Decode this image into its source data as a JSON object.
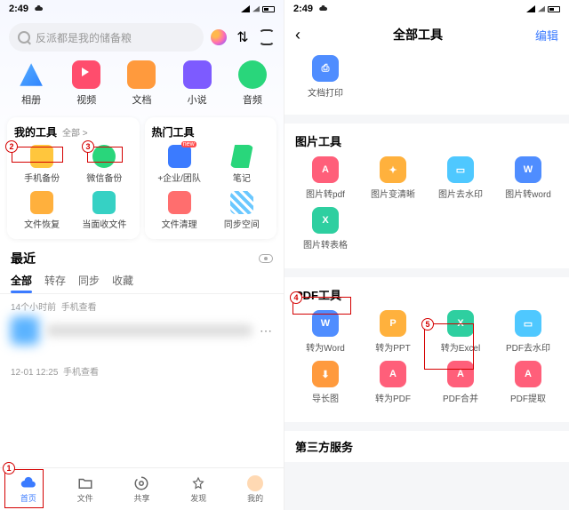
{
  "status": {
    "time": "2:49"
  },
  "left": {
    "search_placeholder": "反派都是我的储备粮",
    "categories": [
      {
        "label": "相册",
        "color": "linear-gradient(135deg,#5bb3ff,#2b7fff)"
      },
      {
        "label": "视频",
        "color": "#ff4d6d"
      },
      {
        "label": "文档",
        "color": "#ff9a3d"
      },
      {
        "label": "小说",
        "color": "#7d5bff"
      },
      {
        "label": "音频",
        "color": "#29d67b"
      }
    ],
    "my_tools": {
      "title": "我的工具",
      "more": "全部 >",
      "items": [
        {
          "label": "手机备份",
          "color": "#ffc63d"
        },
        {
          "label": "微信备份",
          "color": "#29d67b"
        },
        {
          "label": "文件恢复",
          "color": "#ffb03d"
        },
        {
          "label": "当面收文件",
          "color": "#36d1c4"
        }
      ]
    },
    "hot_tools": {
      "title": "热门工具",
      "items": [
        {
          "label": "+企业/团队",
          "color": "#3b7bff",
          "badge": "new"
        },
        {
          "label": "笔记",
          "color": "#29d67b"
        },
        {
          "label": "文件清理",
          "color": "#ff6e6e"
        },
        {
          "label": "同步空间",
          "color": "#6bc8ff"
        }
      ]
    },
    "recent": {
      "title": "最近",
      "tabs": [
        "全部",
        "转存",
        "同步",
        "收藏"
      ],
      "item1_time": "14个小时前",
      "item1_src": "手机查看",
      "item2_time": "12-01 12:25",
      "item2_src": "手机查看"
    },
    "nav": [
      {
        "label": "首页",
        "kind": "cloud"
      },
      {
        "label": "文件",
        "kind": "folder"
      },
      {
        "label": "共享",
        "kind": "share"
      },
      {
        "label": "发现",
        "kind": "discover"
      },
      {
        "label": "我的",
        "kind": "avatar"
      }
    ]
  },
  "right": {
    "title": "全部工具",
    "edit": "编辑",
    "print_label": "文档打印",
    "image_section": {
      "title": "图片工具",
      "items": [
        {
          "label": "图片转pdf",
          "color": "#ff5f7a",
          "glyph": "A"
        },
        {
          "label": "图片变清晰",
          "color": "#ffb13d",
          "glyph": "✦"
        },
        {
          "label": "图片去水印",
          "color": "#4fc8ff",
          "glyph": "▭"
        },
        {
          "label": "图片转word",
          "color": "#4f8dff",
          "glyph": "W"
        },
        {
          "label": "图片转表格",
          "color": "#2ecfa0",
          "glyph": "X"
        }
      ]
    },
    "pdf_section": {
      "title": "PDF工具",
      "items": [
        {
          "label": "转为Word",
          "color": "#4f8dff",
          "glyph": "W"
        },
        {
          "label": "转为PPT",
          "color": "#ffb13d",
          "glyph": "P"
        },
        {
          "label": "转为Excel",
          "color": "#2ecfa0",
          "glyph": "X"
        },
        {
          "label": "PDF去水印",
          "color": "#4fc8ff",
          "glyph": "▭"
        },
        {
          "label": "导长图",
          "color": "#ff9a3d",
          "glyph": "⬇"
        },
        {
          "label": "转为PDF",
          "color": "#ff5f7a",
          "glyph": "A"
        },
        {
          "label": "PDF合并",
          "color": "#ff5f7a",
          "glyph": "A"
        },
        {
          "label": "PDF提取",
          "color": "#ff5f7a",
          "glyph": "A"
        }
      ]
    },
    "third_party": "第三方服务"
  },
  "annotations": {
    "n1": "1",
    "n2": "2",
    "n3": "3",
    "n4": "4",
    "n5": "5"
  }
}
